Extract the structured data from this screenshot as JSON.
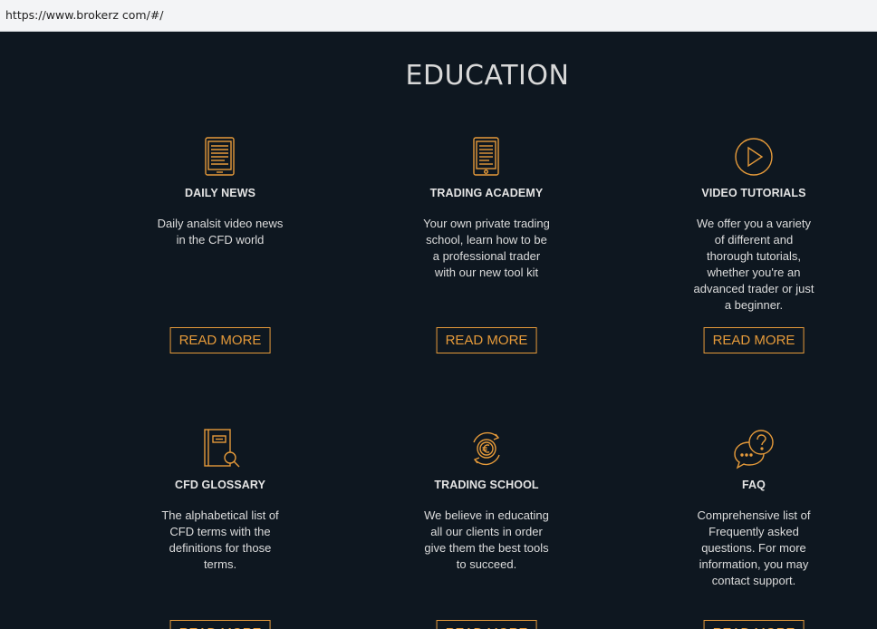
{
  "browser": {
    "url": "https://www.brokerz com/#/"
  },
  "section": {
    "title": "EDUCATION"
  },
  "colors": {
    "background": "#0e1720",
    "accent": "#e59a3a",
    "text": "#dcdcdc"
  },
  "cards": [
    {
      "icon": "tablet-news-icon",
      "title": "DAILY NEWS",
      "desc": "Daily analsit video news in the CFD world",
      "button": "READ MORE"
    },
    {
      "icon": "tablet-academy-icon",
      "title": "TRADING ACADEMY",
      "desc": "Your own private trading school, learn how to be a professional trader with our new tool kit",
      "button": "READ MORE"
    },
    {
      "icon": "play-circle-icon",
      "title": "VIDEO TUTORIALS",
      "desc": "We offer you a variety of different and thorough tutorials, whether you're an advanced trader or just a beginner.",
      "button": "READ MORE"
    },
    {
      "icon": "book-search-icon",
      "title": "CFD GLOSSARY",
      "desc": "The alphabetical list of CFD terms with the definitions for those terms.",
      "button": "READ MORE"
    },
    {
      "icon": "euro-exchange-icon",
      "title": "TRADING SCHOOL",
      "desc": "We believe in educating all our clients in order give them the best tools to succeed.",
      "button": "READ MORE"
    },
    {
      "icon": "question-chat-icon",
      "title": "FAQ",
      "desc": "Comprehensive list of Frequently asked questions. For more information, you may contact support.",
      "button": "READ MORE"
    }
  ]
}
